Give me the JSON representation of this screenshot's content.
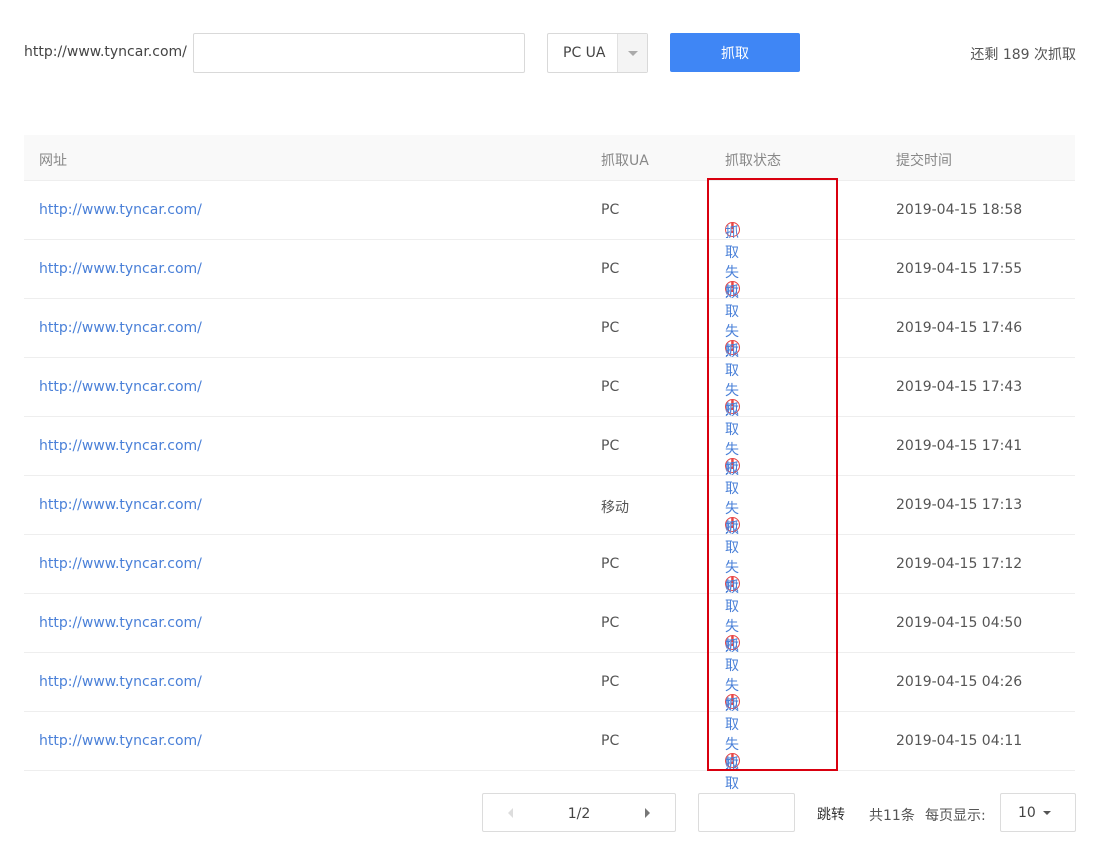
{
  "toolbar": {
    "url_prefix": "http://www.tyncar.com/",
    "path_input_value": "",
    "ua_select_value": "PC UA",
    "fetch_button_label": "抓取",
    "remaining_text": "还剩 189 次抓取"
  },
  "table": {
    "headers": {
      "url": "网址",
      "ua": "抓取UA",
      "status": "抓取状态",
      "time": "提交时间"
    },
    "rows": [
      {
        "url": "http://www.tyncar.com/",
        "ua": "PC",
        "status": "抓取失败",
        "time": "2019-04-15 18:58"
      },
      {
        "url": "http://www.tyncar.com/",
        "ua": "PC",
        "status": "抓取失败",
        "time": "2019-04-15 17:55"
      },
      {
        "url": "http://www.tyncar.com/",
        "ua": "PC",
        "status": "抓取失败",
        "time": "2019-04-15 17:46"
      },
      {
        "url": "http://www.tyncar.com/",
        "ua": "PC",
        "status": "抓取失败",
        "time": "2019-04-15 17:43"
      },
      {
        "url": "http://www.tyncar.com/",
        "ua": "PC",
        "status": "抓取失败",
        "time": "2019-04-15 17:41"
      },
      {
        "url": "http://www.tyncar.com/",
        "ua": "移动",
        "status": "抓取失败",
        "time": "2019-04-15 17:13"
      },
      {
        "url": "http://www.tyncar.com/",
        "ua": "PC",
        "status": "抓取失败",
        "time": "2019-04-15 17:12"
      },
      {
        "url": "http://www.tyncar.com/",
        "ua": "PC",
        "status": "抓取失败",
        "time": "2019-04-15 04:50"
      },
      {
        "url": "http://www.tyncar.com/",
        "ua": "PC",
        "status": "抓取失败",
        "time": "2019-04-15 04:26"
      },
      {
        "url": "http://www.tyncar.com/",
        "ua": "PC",
        "status": "抓取失败",
        "time": "2019-04-15 04:11"
      }
    ],
    "status_icon": "warning-circle-icon"
  },
  "pagination": {
    "page_text": "1/2",
    "jump_input_value": "",
    "jump_label": "跳转",
    "total_text": "共11条",
    "per_page_label": "每页显示:",
    "per_page_value": "10"
  },
  "colors": {
    "accent": "#3f86f5",
    "link": "#4a80d8",
    "error": "#e84545",
    "highlight_box": "#d9000f"
  }
}
